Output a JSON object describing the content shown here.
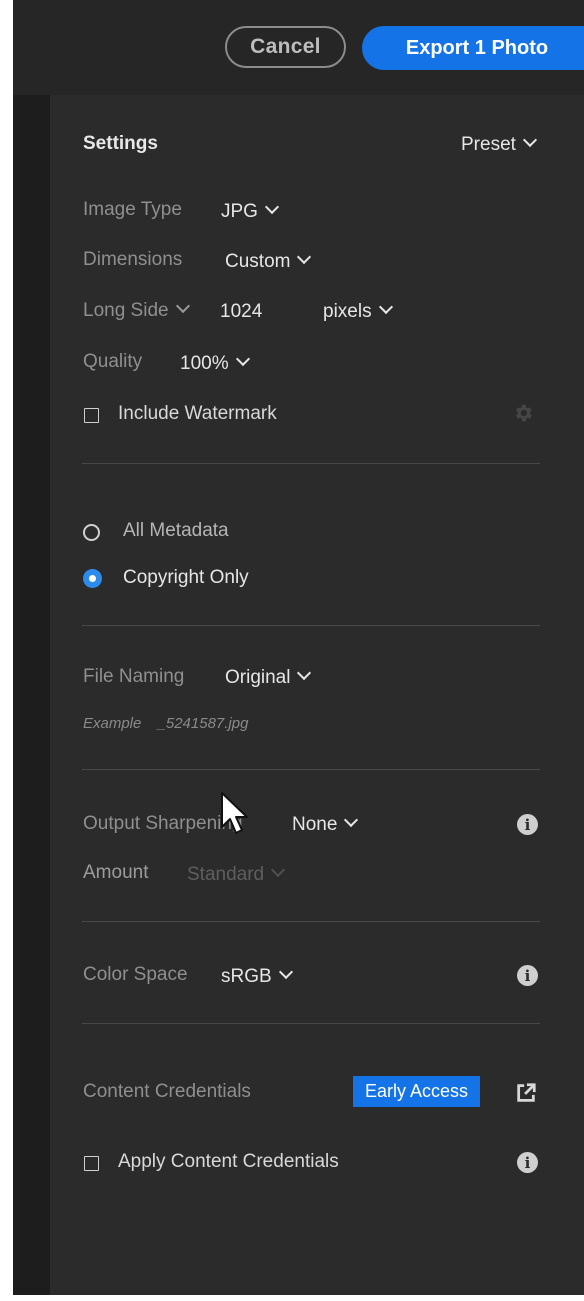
{
  "topbar": {
    "cancel_label": "Cancel",
    "export_label": "Export 1 Photo",
    "accent": "#1473e6"
  },
  "settings": {
    "title": "Settings",
    "preset_label": "Preset",
    "image_type": {
      "label": "Image Type",
      "value": "JPG"
    },
    "dimensions": {
      "label": "Dimensions",
      "value": "Custom"
    },
    "long_side": {
      "label": "Long Side",
      "value": "1024",
      "unit": "pixels"
    },
    "quality": {
      "label": "Quality",
      "value": "100%"
    },
    "watermark": {
      "label": "Include Watermark",
      "checked": false
    }
  },
  "metadata": {
    "options": [
      {
        "label": "All Metadata",
        "selected": false
      },
      {
        "label": "Copyright Only",
        "selected": true
      }
    ]
  },
  "file_naming": {
    "label": "File Naming",
    "value": "Original",
    "example_label": "Example",
    "example_value": "_5241587.jpg"
  },
  "sharpening": {
    "label": "Output Sharpening",
    "value": "None",
    "amount_label": "Amount",
    "amount_value": "Standard"
  },
  "color_space": {
    "label": "Color Space",
    "value": "sRGB"
  },
  "content_credentials": {
    "label": "Content Credentials",
    "badge": "Early Access",
    "apply_label": "Apply Content Credentials",
    "apply_checked": false
  }
}
